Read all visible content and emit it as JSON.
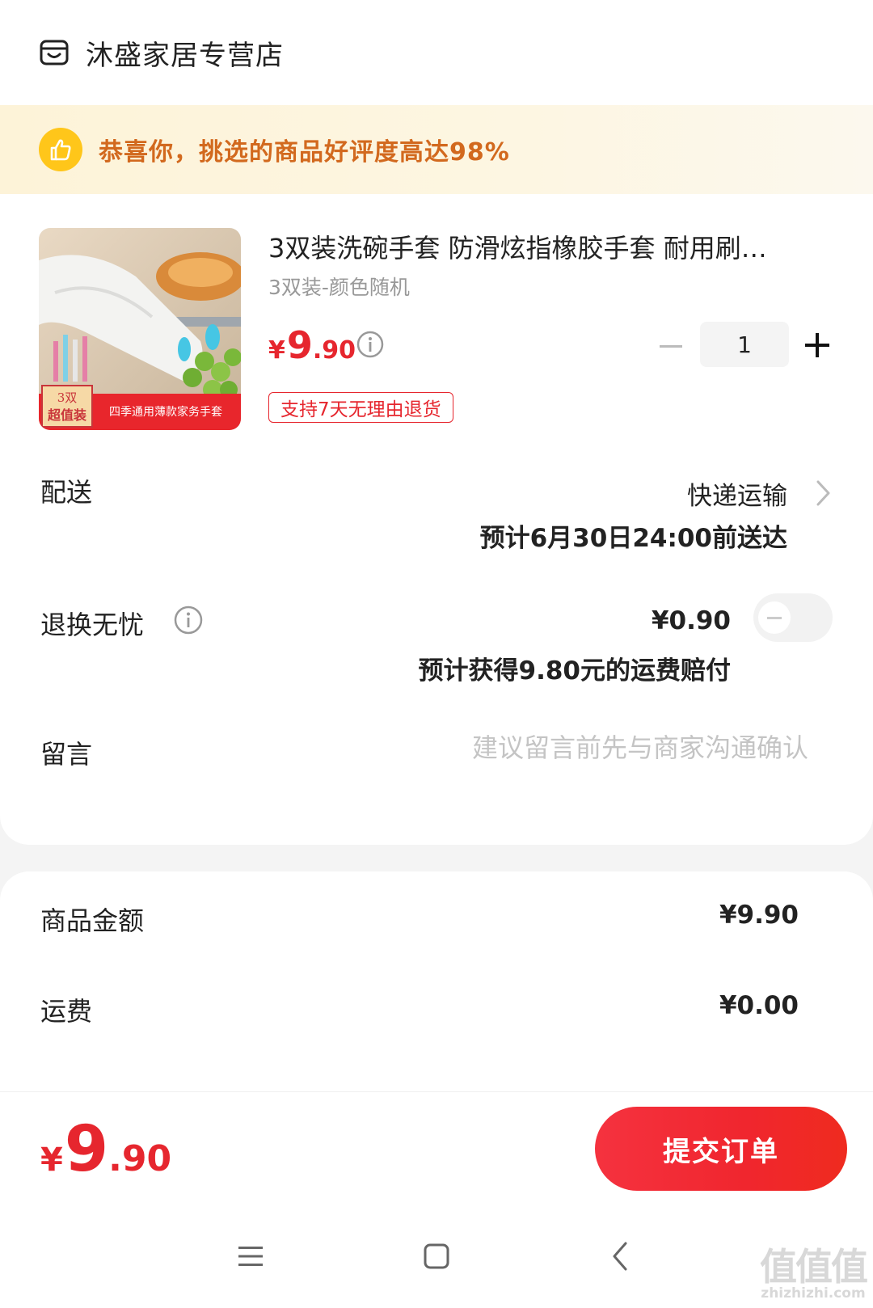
{
  "store": {
    "name": "沐盛家居专营店"
  },
  "promo": {
    "text": "恭喜你，挑选的商品好评度高达98%"
  },
  "product": {
    "title": "3双装洗碗手套 防滑炫指橡胶手套 耐用刷…",
    "sku": "3双装-颜色随机",
    "price_symbol": "¥",
    "price_integer": "9",
    "price_decimal": ".90",
    "return_tag": "支持7天无理由退货",
    "quantity": "1",
    "image_badge_line1": "3双",
    "image_badge_line2": "超值装",
    "image_caption": "四季通用薄款家务手套"
  },
  "delivery": {
    "label": "配送",
    "method": "快递运输",
    "eta": "预计6月30日24:00前送达"
  },
  "insurance": {
    "label": "退换无忧",
    "price": "¥0.90",
    "description": "预计获得9.80元的运费赔付",
    "enabled": false
  },
  "message": {
    "label": "留言",
    "placeholder": "建议留言前先与商家沟通确认"
  },
  "summary": {
    "goods_label": "商品金额",
    "goods_value": "¥9.90",
    "shipping_label": "运费",
    "shipping_value": "¥0.00"
  },
  "checkout": {
    "total_symbol": "¥",
    "total_integer": "9",
    "total_decimal": ".90",
    "submit_label": "提交订单"
  },
  "watermark": {
    "glyphs": "值值值",
    "url": "zhizhizhi.com"
  },
  "colors": {
    "accent": "#e6262e",
    "promo_text": "#d2691e",
    "badge": "#ffc61a"
  }
}
